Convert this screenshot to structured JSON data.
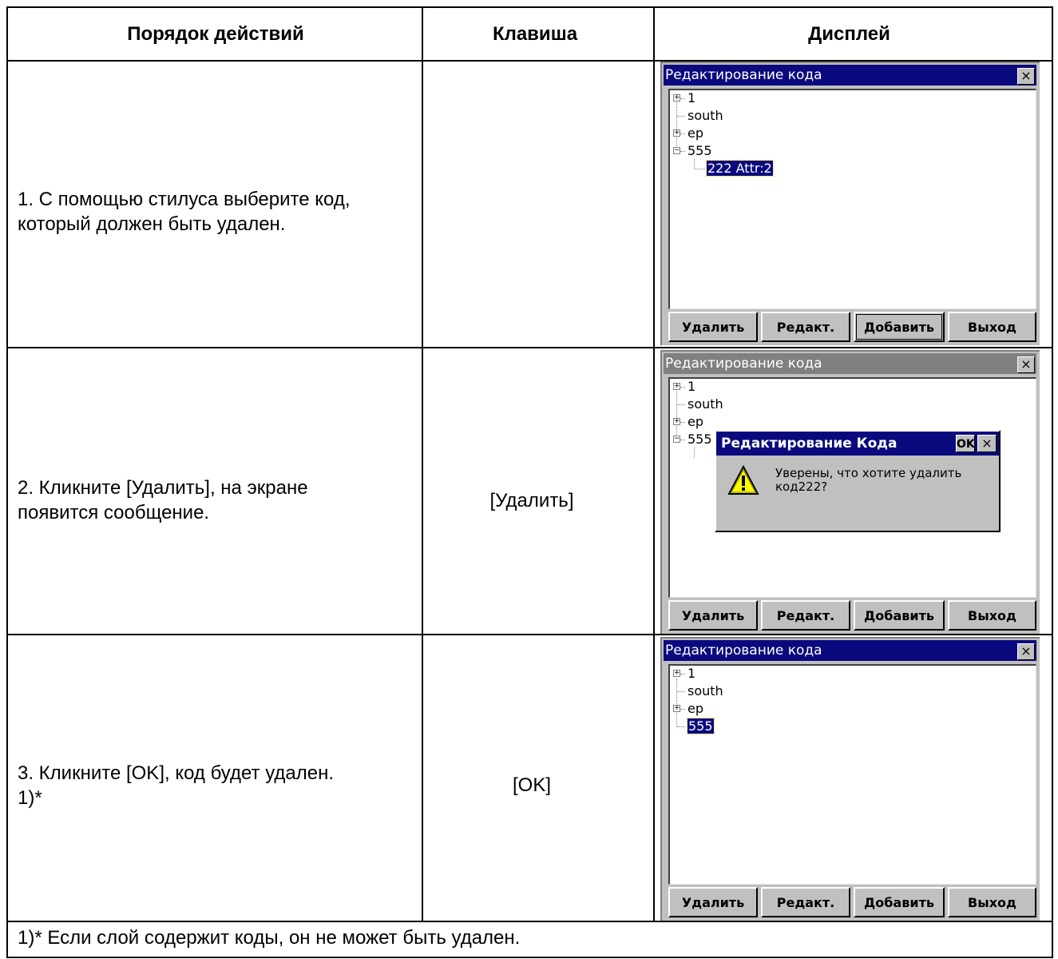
{
  "header": {
    "col1": "Порядок действий",
    "col2": "Клавиша",
    "col3": "Дисплей"
  },
  "steps": [
    {
      "text_line1": "1. С помощью стилуса выберите код,",
      "text_line2": "который должен быть удален.",
      "key": ""
    },
    {
      "text_line1": "2. Кликните [Удалить], на экране",
      "text_line2": "появится сообщение.",
      "key": "[Удалить]"
    },
    {
      "text_line1": "3. Кликните [OK], код будет удален.",
      "text_line2": "1)*",
      "key": "[OK]"
    }
  ],
  "footnote": "1)* Если слой содержит коды, он не может быть удален.",
  "screens": [
    {
      "title": "Редактирование кода",
      "close": "×",
      "tree": [
        "1",
        "south",
        "ep",
        "555",
        "222  Attr:2"
      ],
      "buttons": [
        "Удалить",
        "Редакт.",
        "Добавить",
        "Выход"
      ]
    },
    {
      "title": "Редактирование кода",
      "close": "×",
      "tree": [
        "1",
        "south",
        "ep",
        "555",
        ""
      ],
      "buttons": [
        "Удалить",
        "Редакт.",
        "Добавить",
        "Выход"
      ],
      "dialog": {
        "title": "Редактирование Кода",
        "ok": "OK",
        "close": "×",
        "message_line1": "Уверены, что хотите удалить",
        "message_line2": "код222?",
        "icon": "warning-icon"
      }
    },
    {
      "title": "Редактирование кода",
      "close": "×",
      "tree": [
        "1",
        "south",
        "ep",
        "555"
      ],
      "buttons": [
        "Удалить",
        "Редакт.",
        "Добавить",
        "Выход"
      ]
    }
  ],
  "colors": {
    "titlebar_active": "#0a0a7e",
    "titlebar_inactive": "#808080",
    "face": "#c0c0c0",
    "warning": "#ffff00"
  }
}
